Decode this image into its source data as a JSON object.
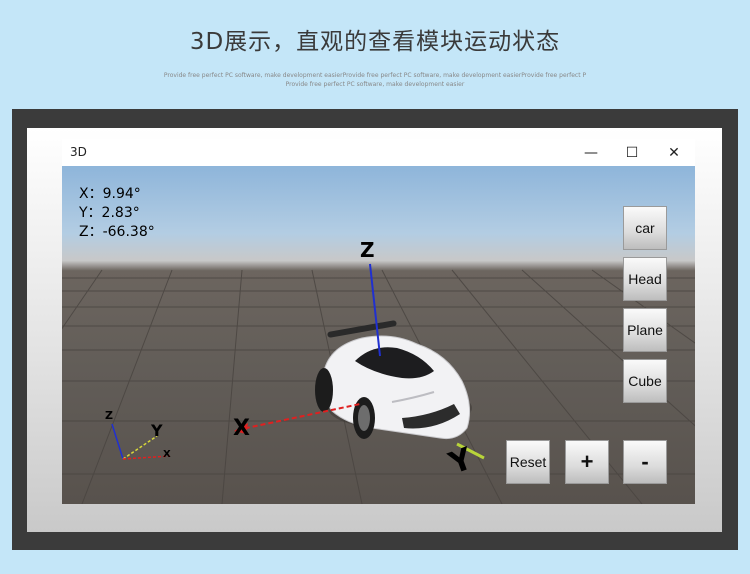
{
  "header": {
    "headline": "3D展示，直观的查看模块运动状态",
    "tagline_1": "Provide free perfect PC software, make development easierProvide free perfect PC software, make development easierProvide free perfect P",
    "tagline_2": "Provide free perfect PC software, make development easier"
  },
  "window": {
    "title": "3D",
    "minimize_glyph": "—",
    "maximize_glyph": "☐",
    "close_glyph": "✕"
  },
  "readout": {
    "x": "X：9.94°",
    "y": "Y：2.83°",
    "z": "Z：-66.38°"
  },
  "axes": {
    "x_label": "X",
    "y_label": "Y",
    "z_label": "Z"
  },
  "buttons": {
    "car": "car",
    "head": "Head",
    "plane": "Plane",
    "cube": "Cube",
    "reset": "Reset",
    "plus": "+",
    "minus": "-"
  },
  "colors": {
    "page_background": "#c4e6f8",
    "x_axis": "#e02020",
    "y_axis": "#b8d43a",
    "z_axis": "#2030d0"
  }
}
